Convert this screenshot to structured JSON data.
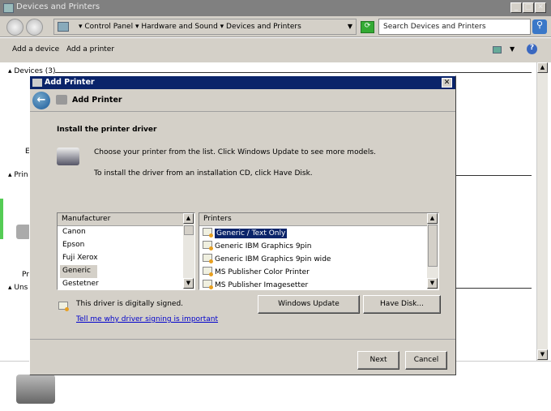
{
  "window": {
    "title": "Devices and Printers"
  },
  "breadcrumb": [
    "Control Panel",
    "Hardware and Sound",
    "Devices and Printers"
  ],
  "search": {
    "placeholder": "Search Devices and Printers"
  },
  "toolbar": {
    "add_device": "Add a device",
    "add_printer": "Add a printer"
  },
  "background": {
    "devices_group": "Devices (3)",
    "printers_group_partial": "Prin",
    "unspecified_group_partial": "Uns",
    "device_label_partial": "E",
    "printer_label_partial": "Pr"
  },
  "dialog": {
    "title": "Add Printer",
    "header": "Add Printer",
    "heading": "Install the printer driver",
    "instruction1": "Choose your printer from the list. Click Windows Update to see more models.",
    "instruction2": "To install the driver from an installation CD, click Have Disk.",
    "manufacturer_header": "Manufacturer",
    "manufacturers": [
      "Canon",
      "Epson",
      "Fuji Xerox",
      "Generic",
      "Gestetner"
    ],
    "selected_manufacturer": "Generic",
    "printers_header": "Printers",
    "printers": [
      "Generic / Text Only",
      "Generic IBM Graphics 9pin",
      "Generic IBM Graphics 9pin wide",
      "MS Publisher Color Printer",
      "MS Publisher Imagesetter"
    ],
    "selected_printer": "Generic / Text Only",
    "signed_text": "This driver is digitally signed.",
    "signing_link": "Tell me why driver signing is important",
    "windows_update": "Windows Update",
    "have_disk": "Have Disk...",
    "next": "Next",
    "cancel": "Cancel"
  },
  "colors": {
    "titlebar": "#0a246a",
    "selection": "#0a246a",
    "link": "#0000cc"
  }
}
